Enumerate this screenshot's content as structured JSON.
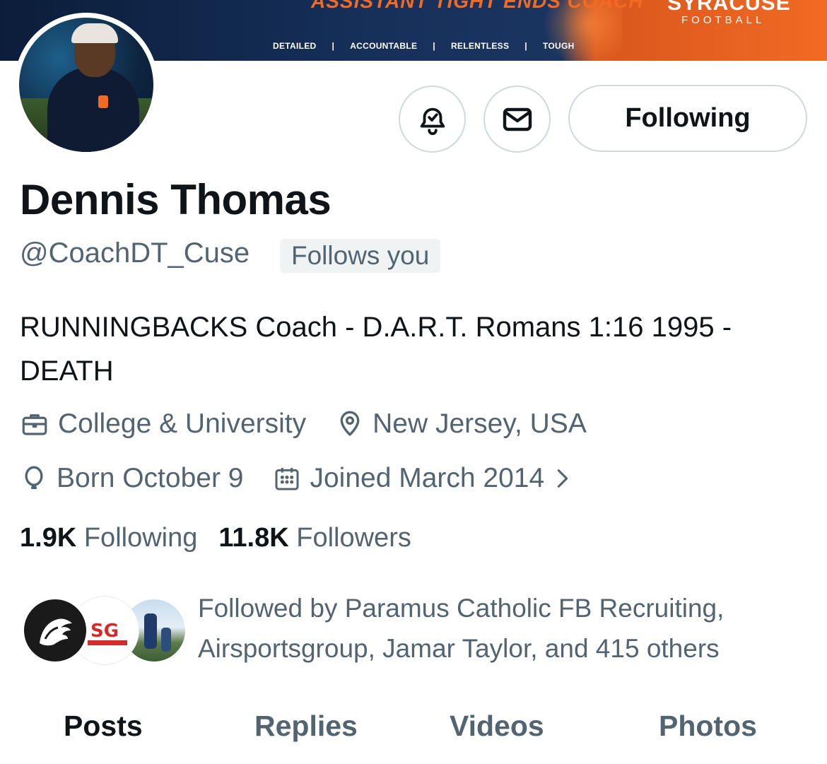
{
  "banner": {
    "title": "ASSISTANT TIGHT ENDS COACH",
    "values": [
      "DETAILED",
      "ACCOUNTABLE",
      "RELENTLESS",
      "TOUGH"
    ],
    "brand": "SYRACUSE",
    "brand_sub": "FOOTBALL",
    "colors": {
      "navy": "#0b1d3a",
      "orange": "#f26a23"
    }
  },
  "profile": {
    "name": "Dennis Thomas",
    "handle": "@CoachDT_Cuse",
    "follows_you_badge": "Follows you",
    "bio": "RUNNINGBACKS Coach - D.A.R.T. Romans 1:16 1995 - DEATH",
    "category": "College & University",
    "location": "New Jersey, USA",
    "birthday": "Born October 9",
    "joined": "Joined March 2014"
  },
  "actions": {
    "notify_icon": "bell-check-icon",
    "message_icon": "envelope-icon",
    "following_label": "Following"
  },
  "stats": {
    "following_count": "1.9K",
    "following_label": "Following",
    "followers_count": "11.8K",
    "followers_label": "Followers"
  },
  "followed_by": {
    "text": "Followed by Paramus Catholic FB Recruiting, Airsportsgroup, Jamar Taylor, and 415 others",
    "avatar2_text": "SG"
  },
  "tabs": [
    {
      "label": "Posts",
      "active": true
    },
    {
      "label": "Replies",
      "active": false
    },
    {
      "label": "Videos",
      "active": false
    },
    {
      "label": "Photos",
      "active": false
    }
  ],
  "colors": {
    "text_primary": "#0f1419",
    "text_secondary": "#536471",
    "border": "#cfd9de",
    "badge_bg": "#eff3f4"
  }
}
